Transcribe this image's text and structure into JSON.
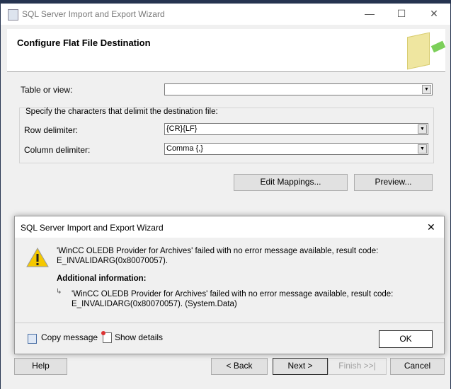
{
  "window": {
    "title": "SQL Server Import and Export Wizard",
    "minimize": "—",
    "maximize": "☐",
    "close": "✕"
  },
  "header": {
    "title": "Configure Flat File Destination"
  },
  "form": {
    "table_label": "Table or view:",
    "table_value": "",
    "group_label": "Specify the characters that delimit the destination file:",
    "row_label": "Row delimiter:",
    "row_value": "{CR}{LF}",
    "col_label": "Column delimiter:",
    "col_value": "Comma {,}",
    "edit_mappings": "Edit Mappings...",
    "preview": "Preview..."
  },
  "dialog": {
    "title": "SQL Server Import and Export Wizard",
    "close": "✕",
    "message": "'WinCC OLEDB Provider for Archives' failed with no error message available, result code: E_INVALIDARG(0x80070057).",
    "additional_heading": "Additional information:",
    "additional_text": "'WinCC OLEDB Provider for Archives' failed with no error message available, result code: E_INVALIDARG(0x80070057). (System.Data)",
    "copy_message": "Copy message",
    "show_details": "Show details",
    "ok": "OK"
  },
  "footer": {
    "help": "Help",
    "back": "< Back",
    "next": "Next >",
    "finish": "Finish >>|",
    "cancel": "Cancel"
  }
}
